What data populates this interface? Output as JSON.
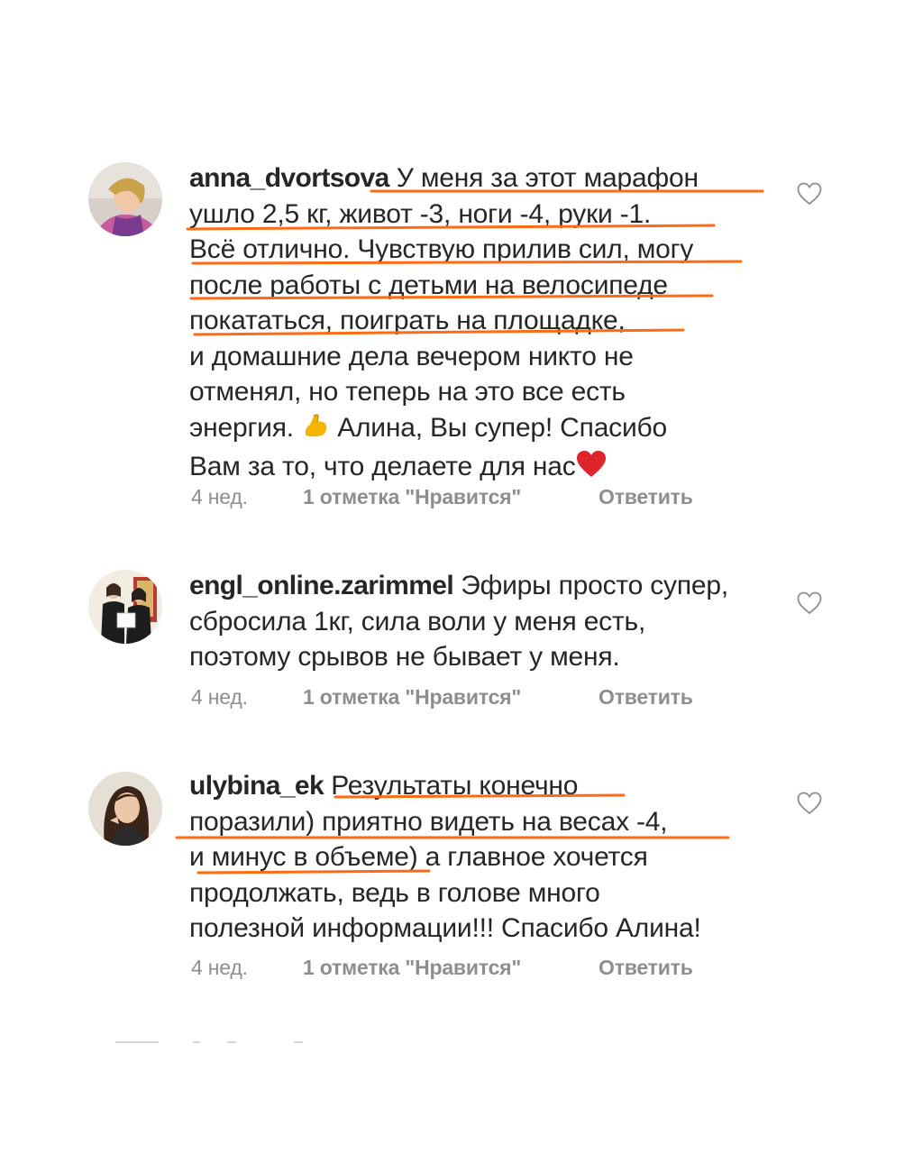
{
  "comments": [
    {
      "username": "anna_dvortsova",
      "first_line_text": " У меня за этот марафон",
      "lines": [
        "ушло 2,5 кг, живот -3, ноги -4, руки -1.",
        "Всё отлично. Чувствую прилив сил, могу",
        "после работы с детьми на велосипеде",
        "покататься, поиграть на площадке,",
        "и домашние дела вечером никто не",
        "отменял, но теперь на это все есть"
      ],
      "line7_before": "энергия. ",
      "line7_after": " Алина, Вы супер! Спасибо",
      "line8": "Вам за то, что делаете для нас",
      "emoji_inline": "flexed-biceps-icon",
      "emoji_end": "red-heart-icon",
      "time": "4 нед.",
      "likes": "1 отметка \"Нравится\"",
      "reply": "Ответить"
    },
    {
      "username": "engl_online.zarimmel",
      "first_line_text": " Эфиры просто супер,",
      "lines": [
        "сбросила 1кг, сила воли у меня есть,",
        "поэтому срывов не бывает у меня."
      ],
      "time": "4 нед.",
      "likes": "1 отметка \"Нравится\"",
      "reply": "Ответить"
    },
    {
      "username": "ulybina_ek",
      "first_line_text": " Результаты конечно",
      "lines": [
        "поразили) приятно видеть на весах -4,",
        "и минус в объеме) а главное хочется",
        "продолжать, ведь в голове много",
        "полезной информации!!! Спасибо Алина!"
      ],
      "time": "4 нед.",
      "likes": "1 отметка \"Нравится\"",
      "reply": "Ответить"
    }
  ],
  "colors": {
    "text": "#262626",
    "meta": "#8e8e8e",
    "highlight": "#ff6a13",
    "heart": "#e0242b"
  },
  "icons": [
    "avatar",
    "like-heart-icon",
    "flexed-biceps-icon",
    "red-heart-icon"
  ]
}
